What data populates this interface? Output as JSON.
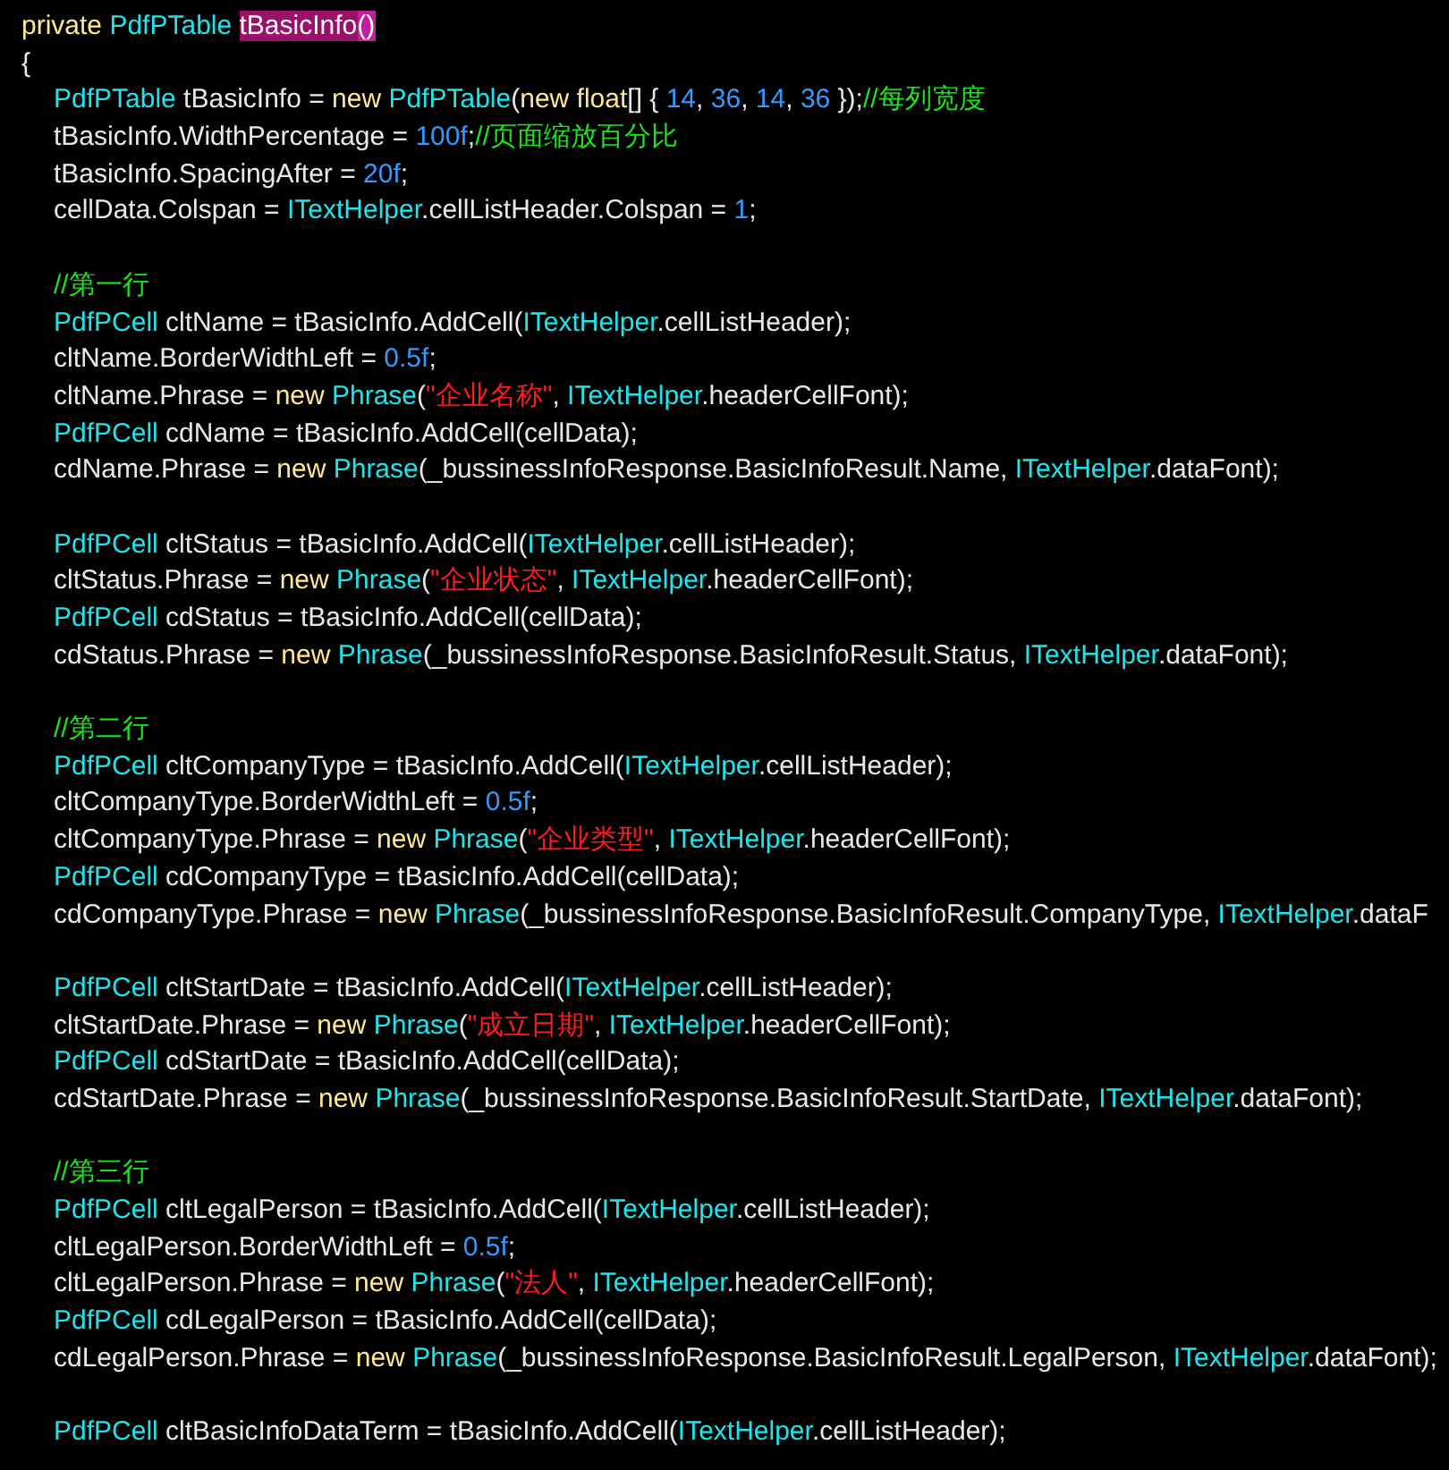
{
  "code": {
    "lines": [
      {
        "kind": "code",
        "tokens": [
          {
            "t": "private ",
            "kind": "kw"
          },
          {
            "t": "PdfPTable ",
            "kind": "type"
          },
          {
            "t": "tBasicInfo",
            "kind": "sel"
          },
          {
            "t": "()",
            "kind": "match"
          }
        ]
      },
      {
        "kind": "code",
        "tokens": [
          {
            "t": "{",
            "kind": "plain"
          }
        ]
      },
      {
        "kind": "block",
        "children": [
          {
            "kind": "code",
            "tokens": [
              {
                "t": "PdfPTable",
                "kind": "type"
              },
              {
                "t": " tBasicInfo = ",
                "kind": "plain"
              },
              {
                "t": "new ",
                "kind": "kw"
              },
              {
                "t": "PdfPTable",
                "kind": "type"
              },
              {
                "t": "(",
                "kind": "plain"
              },
              {
                "t": "new float",
                "kind": "kw"
              },
              {
                "t": "[] { ",
                "kind": "plain"
              },
              {
                "t": "14",
                "kind": "num"
              },
              {
                "t": ", ",
                "kind": "plain"
              },
              {
                "t": "36",
                "kind": "num"
              },
              {
                "t": ", ",
                "kind": "plain"
              },
              {
                "t": "14",
                "kind": "num"
              },
              {
                "t": ", ",
                "kind": "plain"
              },
              {
                "t": "36",
                "kind": "num"
              },
              {
                "t": " });",
                "kind": "plain"
              },
              {
                "t": "//每列宽度",
                "kind": "comment"
              }
            ]
          },
          {
            "kind": "code",
            "tokens": [
              {
                "t": "tBasicInfo.WidthPercentage = ",
                "kind": "plain"
              },
              {
                "t": "100f",
                "kind": "num"
              },
              {
                "t": ";",
                "kind": "plain"
              },
              {
                "t": "//页面缩放百分比",
                "kind": "comment"
              }
            ]
          },
          {
            "kind": "code",
            "tokens": [
              {
                "t": "tBasicInfo.SpacingAfter = ",
                "kind": "plain"
              },
              {
                "t": "20f",
                "kind": "num"
              },
              {
                "t": ";",
                "kind": "plain"
              }
            ]
          },
          {
            "kind": "code",
            "tokens": [
              {
                "t": "cellData.Colspan = ",
                "kind": "plain"
              },
              {
                "t": "ITextHelper",
                "kind": "type"
              },
              {
                "t": ".cellListHeader.Colspan = ",
                "kind": "plain"
              },
              {
                "t": "1",
                "kind": "num"
              },
              {
                "t": ";",
                "kind": "plain"
              }
            ]
          },
          {
            "kind": "blank"
          },
          {
            "kind": "code",
            "tokens": [
              {
                "t": "//第一行",
                "kind": "comment"
              }
            ]
          },
          {
            "kind": "code",
            "tokens": [
              {
                "t": "PdfPCell",
                "kind": "type"
              },
              {
                "t": " cltName = tBasicInfo.AddCell(",
                "kind": "plain"
              },
              {
                "t": "ITextHelper",
                "kind": "type"
              },
              {
                "t": ".cellListHeader);",
                "kind": "plain"
              }
            ]
          },
          {
            "kind": "code",
            "tokens": [
              {
                "t": "cltName.BorderWidthLeft = ",
                "kind": "plain"
              },
              {
                "t": "0.5f",
                "kind": "num"
              },
              {
                "t": ";",
                "kind": "plain"
              }
            ]
          },
          {
            "kind": "code",
            "tokens": [
              {
                "t": "cltName.Phrase = ",
                "kind": "plain"
              },
              {
                "t": "new ",
                "kind": "kw"
              },
              {
                "t": "Phrase",
                "kind": "type"
              },
              {
                "t": "(",
                "kind": "plain"
              },
              {
                "t": "\"企业名称\"",
                "kind": "str"
              },
              {
                "t": ", ",
                "kind": "plain"
              },
              {
                "t": "ITextHelper",
                "kind": "type"
              },
              {
                "t": ".headerCellFont);",
                "kind": "plain"
              }
            ]
          },
          {
            "kind": "code",
            "tokens": [
              {
                "t": "PdfPCell",
                "kind": "type"
              },
              {
                "t": " cdName = tBasicInfo.AddCell(cellData);",
                "kind": "plain"
              }
            ]
          },
          {
            "kind": "code",
            "tokens": [
              {
                "t": "cdName.Phrase = ",
                "kind": "plain"
              },
              {
                "t": "new ",
                "kind": "kw"
              },
              {
                "t": "Phrase",
                "kind": "type"
              },
              {
                "t": "(_bussinessInfoResponse.BasicInfoResult.Name, ",
                "kind": "plain"
              },
              {
                "t": "ITextHelper",
                "kind": "type"
              },
              {
                "t": ".dataFont);",
                "kind": "plain"
              }
            ]
          },
          {
            "kind": "blank"
          },
          {
            "kind": "code",
            "tokens": [
              {
                "t": "PdfPCell",
                "kind": "type"
              },
              {
                "t": " cltStatus = tBasicInfo.AddCell(",
                "kind": "plain"
              },
              {
                "t": "ITextHelper",
                "kind": "type"
              },
              {
                "t": ".cellListHeader);",
                "kind": "plain"
              }
            ]
          },
          {
            "kind": "code",
            "tokens": [
              {
                "t": "cltStatus.Phrase = ",
                "kind": "plain"
              },
              {
                "t": "new ",
                "kind": "kw"
              },
              {
                "t": "Phrase",
                "kind": "type"
              },
              {
                "t": "(",
                "kind": "plain"
              },
              {
                "t": "\"企业状态\"",
                "kind": "str"
              },
              {
                "t": ", ",
                "kind": "plain"
              },
              {
                "t": "ITextHelper",
                "kind": "type"
              },
              {
                "t": ".headerCellFont);",
                "kind": "plain"
              }
            ]
          },
          {
            "kind": "code",
            "tokens": [
              {
                "t": "PdfPCell",
                "kind": "type"
              },
              {
                "t": " cdStatus = tBasicInfo.AddCell(cellData);",
                "kind": "plain"
              }
            ]
          },
          {
            "kind": "code",
            "tokens": [
              {
                "t": "cdStatus.Phrase = ",
                "kind": "plain"
              },
              {
                "t": "new ",
                "kind": "kw"
              },
              {
                "t": "Phrase",
                "kind": "type"
              },
              {
                "t": "(_bussinessInfoResponse.BasicInfoResult.Status, ",
                "kind": "plain"
              },
              {
                "t": "ITextHelper",
                "kind": "type"
              },
              {
                "t": ".dataFont);",
                "kind": "plain"
              }
            ]
          },
          {
            "kind": "blank"
          },
          {
            "kind": "code",
            "tokens": [
              {
                "t": "//第二行",
                "kind": "comment"
              }
            ]
          },
          {
            "kind": "code",
            "tokens": [
              {
                "t": "PdfPCell",
                "kind": "type"
              },
              {
                "t": " cltCompanyType = tBasicInfo.AddCell(",
                "kind": "plain"
              },
              {
                "t": "ITextHelper",
                "kind": "type"
              },
              {
                "t": ".cellListHeader);",
                "kind": "plain"
              }
            ]
          },
          {
            "kind": "code",
            "tokens": [
              {
                "t": "cltCompanyType.BorderWidthLeft = ",
                "kind": "plain"
              },
              {
                "t": "0.5f",
                "kind": "num"
              },
              {
                "t": ";",
                "kind": "plain"
              }
            ]
          },
          {
            "kind": "code",
            "tokens": [
              {
                "t": "cltCompanyType.Phrase = ",
                "kind": "plain"
              },
              {
                "t": "new ",
                "kind": "kw"
              },
              {
                "t": "Phrase",
                "kind": "type"
              },
              {
                "t": "(",
                "kind": "plain"
              },
              {
                "t": "\"企业类型\"",
                "kind": "str"
              },
              {
                "t": ", ",
                "kind": "plain"
              },
              {
                "t": "ITextHelper",
                "kind": "type"
              },
              {
                "t": ".headerCellFont);",
                "kind": "plain"
              }
            ]
          },
          {
            "kind": "code",
            "tokens": [
              {
                "t": "PdfPCell",
                "kind": "type"
              },
              {
                "t": " cdCompanyType = tBasicInfo.AddCell(cellData);",
                "kind": "plain"
              }
            ]
          },
          {
            "kind": "code",
            "tokens": [
              {
                "t": "cdCompanyType.Phrase = ",
                "kind": "plain"
              },
              {
                "t": "new ",
                "kind": "kw"
              },
              {
                "t": "Phrase",
                "kind": "type"
              },
              {
                "t": "(_bussinessInfoResponse.BasicInfoResult.CompanyType, ",
                "kind": "plain"
              },
              {
                "t": "ITextHelper",
                "kind": "type"
              },
              {
                "t": ".dataF",
                "kind": "plain"
              }
            ]
          },
          {
            "kind": "blank"
          },
          {
            "kind": "code",
            "tokens": [
              {
                "t": "PdfPCell",
                "kind": "type"
              },
              {
                "t": " cltStartDate = tBasicInfo.AddCell(",
                "kind": "plain"
              },
              {
                "t": "ITextHelper",
                "kind": "type"
              },
              {
                "t": ".cellListHeader);",
                "kind": "plain"
              }
            ]
          },
          {
            "kind": "code",
            "tokens": [
              {
                "t": "cltStartDate.Phrase = ",
                "kind": "plain"
              },
              {
                "t": "new ",
                "kind": "kw"
              },
              {
                "t": "Phrase",
                "kind": "type"
              },
              {
                "t": "(",
                "kind": "plain"
              },
              {
                "t": "\"成立日期\"",
                "kind": "str"
              },
              {
                "t": ", ",
                "kind": "plain"
              },
              {
                "t": "ITextHelper",
                "kind": "type"
              },
              {
                "t": ".headerCellFont);",
                "kind": "plain"
              }
            ]
          },
          {
            "kind": "code",
            "tokens": [
              {
                "t": "PdfPCell",
                "kind": "type"
              },
              {
                "t": " cdStartDate = tBasicInfo.AddCell(cellData);",
                "kind": "plain"
              }
            ]
          },
          {
            "kind": "code",
            "tokens": [
              {
                "t": "cdStartDate.Phrase = ",
                "kind": "plain"
              },
              {
                "t": "new ",
                "kind": "kw"
              },
              {
                "t": "Phrase",
                "kind": "type"
              },
              {
                "t": "(_bussinessInfoResponse.BasicInfoResult.StartDate, ",
                "kind": "plain"
              },
              {
                "t": "ITextHelper",
                "kind": "type"
              },
              {
                "t": ".dataFont);",
                "kind": "plain"
              }
            ]
          },
          {
            "kind": "blank"
          },
          {
            "kind": "code",
            "tokens": [
              {
                "t": "//第三行",
                "kind": "comment"
              }
            ]
          },
          {
            "kind": "code",
            "tokens": [
              {
                "t": "PdfPCell",
                "kind": "type"
              },
              {
                "t": " cltLegalPerson = tBasicInfo.AddCell(",
                "kind": "plain"
              },
              {
                "t": "ITextHelper",
                "kind": "type"
              },
              {
                "t": ".cellListHeader);",
                "kind": "plain"
              }
            ]
          },
          {
            "kind": "code",
            "tokens": [
              {
                "t": "cltLegalPerson.BorderWidthLeft = ",
                "kind": "plain"
              },
              {
                "t": "0.5f",
                "kind": "num"
              },
              {
                "t": ";",
                "kind": "plain"
              }
            ]
          },
          {
            "kind": "code",
            "tokens": [
              {
                "t": "cltLegalPerson.Phrase = ",
                "kind": "plain"
              },
              {
                "t": "new ",
                "kind": "kw"
              },
              {
                "t": "Phrase",
                "kind": "type"
              },
              {
                "t": "(",
                "kind": "plain"
              },
              {
                "t": "\"法人\"",
                "kind": "str"
              },
              {
                "t": ", ",
                "kind": "plain"
              },
              {
                "t": "ITextHelper",
                "kind": "type"
              },
              {
                "t": ".headerCellFont);",
                "kind": "plain"
              }
            ]
          },
          {
            "kind": "code",
            "tokens": [
              {
                "t": "PdfPCell",
                "kind": "type"
              },
              {
                "t": " cdLegalPerson = tBasicInfo.AddCell(cellData);",
                "kind": "plain"
              }
            ]
          },
          {
            "kind": "code",
            "tokens": [
              {
                "t": "cdLegalPerson.Phrase = ",
                "kind": "plain"
              },
              {
                "t": "new ",
                "kind": "kw"
              },
              {
                "t": "Phrase",
                "kind": "type"
              },
              {
                "t": "(_bussinessInfoResponse.BasicInfoResult.LegalPerson, ",
                "kind": "plain"
              },
              {
                "t": "ITextHelper",
                "kind": "type"
              },
              {
                "t": ".dataFont);",
                "kind": "plain"
              }
            ]
          },
          {
            "kind": "blank"
          },
          {
            "kind": "code",
            "tokens": [
              {
                "t": "PdfPCell",
                "kind": "type"
              },
              {
                "t": " cltBasicInfoDataTerm = tBasicInfo.AddCell(",
                "kind": "plain"
              },
              {
                "t": "ITextHelper",
                "kind": "type"
              },
              {
                "t": ".cellListHeader);",
                "kind": "plain"
              }
            ]
          }
        ]
      }
    ]
  }
}
